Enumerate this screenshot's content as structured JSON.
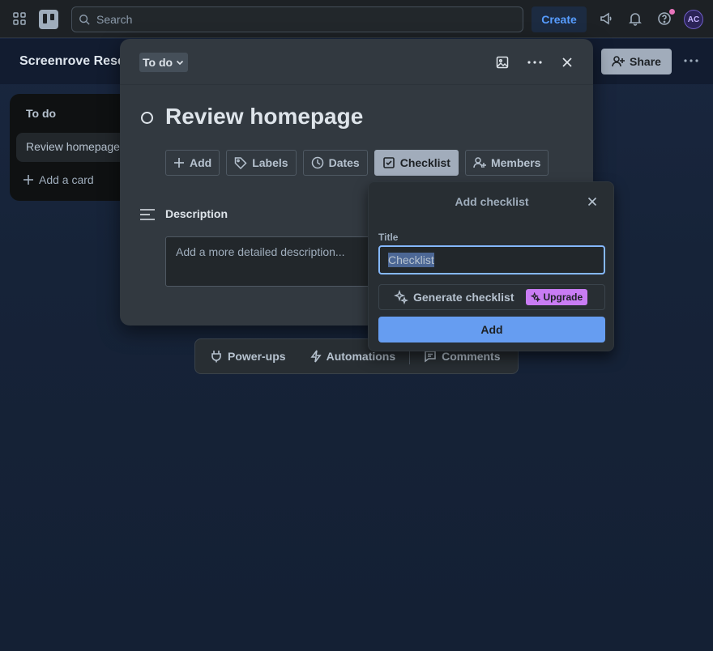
{
  "topbar": {
    "search_placeholder": "Search",
    "create_label": "Create",
    "avatar_initials": "AC"
  },
  "board": {
    "title": "Screenrove Rese",
    "share_label": "Share"
  },
  "list": {
    "title": "To do",
    "cards": [
      "Review homepage"
    ],
    "add_card_label": "Add a card"
  },
  "modal": {
    "list_name": "To do",
    "card_title": "Review homepage",
    "actions": [
      {
        "label": "Add",
        "icon": "plus-icon"
      },
      {
        "label": "Labels",
        "icon": "tag-icon"
      },
      {
        "label": "Dates",
        "icon": "clock-icon"
      },
      {
        "label": "Checklist",
        "icon": "checkbox-icon",
        "active": true
      },
      {
        "label": "Members",
        "icon": "add-member-icon"
      }
    ],
    "description_label": "Description",
    "description_placeholder": "Add a more detailed description..."
  },
  "bottom_bar": {
    "powerups_label": "Power-ups",
    "automations_label": "Automations",
    "comments_label": "Comments"
  },
  "popover": {
    "title": "Add checklist",
    "field_label": "Title",
    "field_value": "Checklist",
    "generate_label": "Generate checklist",
    "upgrade_label": "Upgrade",
    "add_label": "Add"
  },
  "colors": {
    "accent": "#669df1",
    "focus_ring": "#85b8ff",
    "upgrade": "#c97cf4",
    "modal_bg": "#323940"
  }
}
